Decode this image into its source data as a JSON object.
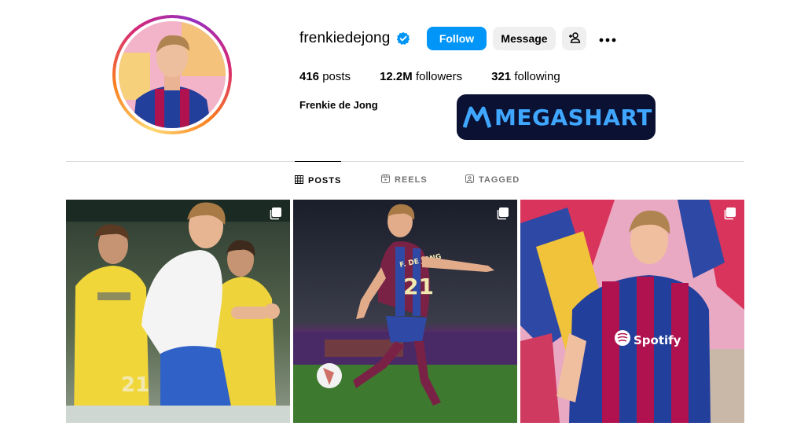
{
  "profile": {
    "username": "frenkiedejong",
    "full_name": "Frenkie de Jong",
    "verified": true,
    "avatar_icon": "profile-photo"
  },
  "actions": {
    "follow_label": "Follow",
    "message_label": "Message",
    "add_user_icon": "add-person-icon",
    "more_icon": "more-horizontal-icon"
  },
  "stats": {
    "posts_count": "416",
    "posts_label": "posts",
    "followers_count": "12.2M",
    "followers_label": "followers",
    "following_count": "321",
    "following_label": "following"
  },
  "watermark": {
    "text": "MEGASHART"
  },
  "tabs": [
    {
      "label": "POSTS",
      "icon": "grid-icon",
      "active": true
    },
    {
      "label": "REELS",
      "icon": "reels-icon",
      "active": false
    },
    {
      "label": "TAGGED",
      "icon": "tagged-icon",
      "active": false
    }
  ],
  "posts": [
    {
      "type": "carousel",
      "description_icon": "carousel-icon",
      "shirt_number": "21"
    },
    {
      "type": "carousel",
      "description_icon": "carousel-icon",
      "shirt_name": "F. DE JONG",
      "shirt_number": "21"
    },
    {
      "type": "carousel",
      "description_icon": "carousel-icon",
      "sponsor": "Spotify"
    }
  ],
  "colors": {
    "accent": "#0095f6",
    "secondary_button": "#efefef",
    "text_muted": "#737373",
    "divider": "#dbdbdb",
    "barca_blue": "#1f3f9b",
    "barca_red": "#a50044"
  }
}
